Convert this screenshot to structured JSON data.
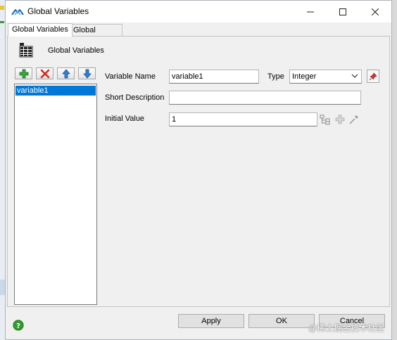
{
  "window": {
    "title": "Global Variables",
    "controls": {
      "minimize": "—",
      "maximize": "☐",
      "close": "✕"
    }
  },
  "tabs": [
    {
      "label": "Global Variables",
      "active": true
    },
    {
      "label": "Global Macros",
      "active": false
    }
  ],
  "panel": {
    "heading": "Global Variables",
    "heading_icon": "grid-table-icon"
  },
  "toolbar": {
    "add_icon": "green-plus-icon",
    "delete_icon": "red-x-icon",
    "move_up_icon": "blue-up-arrow-icon",
    "move_down_icon": "blue-down-arrow-icon"
  },
  "variables": [
    "variable1"
  ],
  "form": {
    "variable_name_label": "Variable Name",
    "variable_name_value": "variable1",
    "type_label": "Type",
    "type_value": "Integer",
    "short_description_label": "Short Description",
    "short_description_value": "",
    "initial_value_label": "Initial Value",
    "initial_value_value": "1"
  },
  "buttons": {
    "apply": "Apply",
    "ok": "OK",
    "cancel": "Cancel"
  },
  "watermark": "@稀土掘金技术社区",
  "colors": {
    "selection": "#0078d7",
    "window_bg": "#f0f0f0",
    "help_green": "#2f9e2f"
  }
}
